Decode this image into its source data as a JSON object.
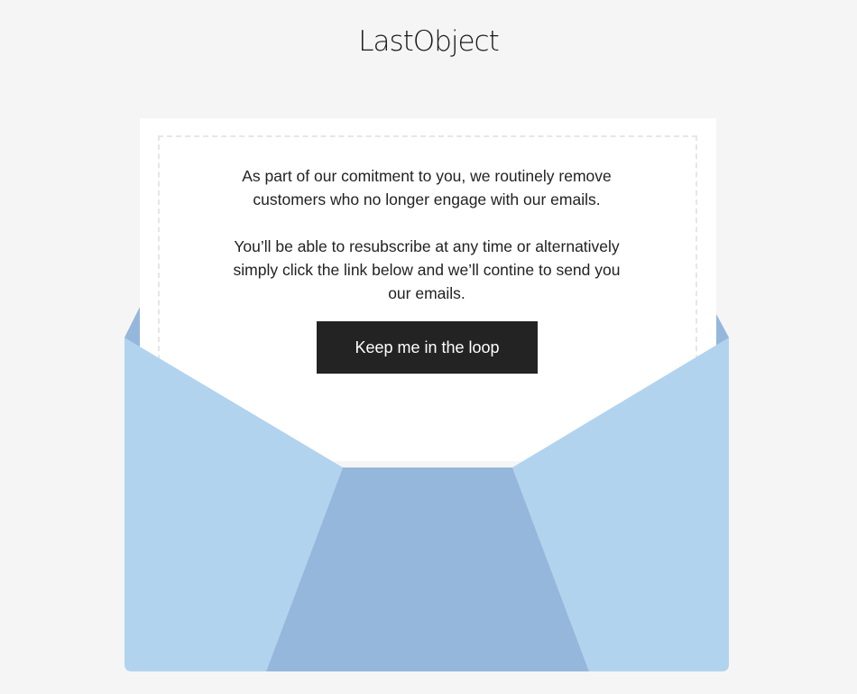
{
  "brand": {
    "logo_text": "LastObject"
  },
  "email": {
    "paragraph_1": "As part of our comitment to you, we routinely remove customers who no longer engage with our emails.",
    "paragraph_2": "You’ll be able to resubscribe at any time or alternatively simply click the link below and we’ll contine to send you our emails.",
    "cta_label": "Keep me in the loop"
  },
  "colors": {
    "background": "#f5f5f6",
    "envelope_light": "#b2d3ee",
    "envelope_dark": "#96b7dc",
    "button": "#232323",
    "button_text": "#ffffff"
  },
  "icons": {
    "envelope": "envelope-illustration"
  }
}
